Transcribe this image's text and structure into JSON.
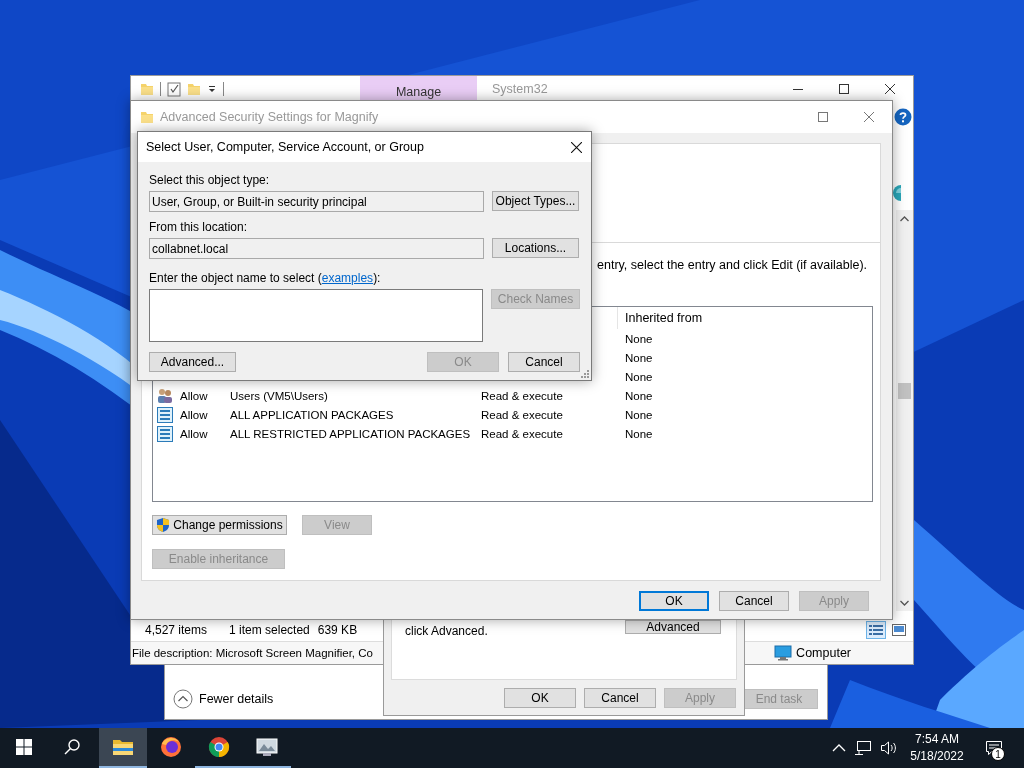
{
  "explorer": {
    "ribbon_tab": "Manage",
    "title": "System32",
    "status_bar": {
      "item_count": "4,527 items",
      "selection": "1 item selected",
      "size": "639 KB"
    },
    "details_bar": {
      "description": "File description: Microsoft Screen Magnifier, Co",
      "location": "Computer"
    }
  },
  "task_manager": {
    "details_toggle": "Fewer details",
    "buttons": [
      {
        "label": "End task",
        "disabled": true,
        "default": false
      }
    ]
  },
  "properties_dialog": {
    "hint": "click Advanced.",
    "advanced_button": "Advanced",
    "buttons": [
      {
        "label": "OK",
        "disabled": false,
        "default": false
      },
      {
        "label": "Cancel",
        "disabled": false,
        "default": false
      },
      {
        "label": "Apply",
        "disabled": true,
        "default": false
      }
    ]
  },
  "advanced_security": {
    "title": "Advanced Security Settings for Magnify",
    "instruction": "entry, select the entry and click Edit (if available).",
    "inherited_header": "Inherited from",
    "entries": [
      {
        "inherited": "None"
      },
      {
        "inherited": "None"
      },
      {
        "inherited": "None"
      },
      {
        "kind": "group",
        "type": "Allow",
        "principal": "Users (VM5\\Users)",
        "access": "Read & execute",
        "inherited": "None"
      },
      {
        "kind": "package",
        "type": "Allow",
        "principal": "ALL APPLICATION PACKAGES",
        "access": "Read & execute",
        "inherited": "None"
      },
      {
        "kind": "package",
        "type": "Allow",
        "principal": "ALL RESTRICTED APPLICATION PACKAGES",
        "access": "Read & execute",
        "inherited": "None"
      }
    ],
    "actions": [
      {
        "label": "Change permissions",
        "disabled": false,
        "shield": true
      },
      {
        "label": "View",
        "disabled": true,
        "shield": false
      }
    ],
    "inheritance_button": {
      "label": "Enable inheritance",
      "disabled": true
    },
    "buttons": [
      {
        "label": "OK",
        "disabled": false,
        "default": true
      },
      {
        "label": "Cancel",
        "disabled": false,
        "default": false
      },
      {
        "label": "Apply",
        "disabled": true,
        "default": false
      }
    ]
  },
  "select_dialog": {
    "title": "Select User, Computer, Service Account, or Group",
    "object_type_label": "Select this object type:",
    "object_type": "User, Group, or Built-in security principal",
    "object_types_button": "Object Types...",
    "location_label": "From this location:",
    "location": "collabnet.local",
    "locations_button": "Locations...",
    "name_label": {
      "before": "Enter the object name to select (",
      "link": "examples",
      "after": "):"
    },
    "check_names": {
      "label": "Check Names",
      "disabled": true
    },
    "advanced_button": "Advanced...",
    "buttons": [
      {
        "label": "OK",
        "disabled": true,
        "default": false
      },
      {
        "label": "Cancel",
        "disabled": false,
        "default": false
      }
    ]
  },
  "taskbar": {
    "apps": [
      {
        "kind": "explorer",
        "active": true,
        "running": true
      },
      {
        "kind": "firefox",
        "active": false,
        "running": false
      },
      {
        "kind": "chrome",
        "active": false,
        "running": true
      },
      {
        "kind": "viewer",
        "active": false,
        "running": true
      }
    ],
    "time": "7:54 AM",
    "date": "5/18/2022",
    "notifications": "1"
  }
}
